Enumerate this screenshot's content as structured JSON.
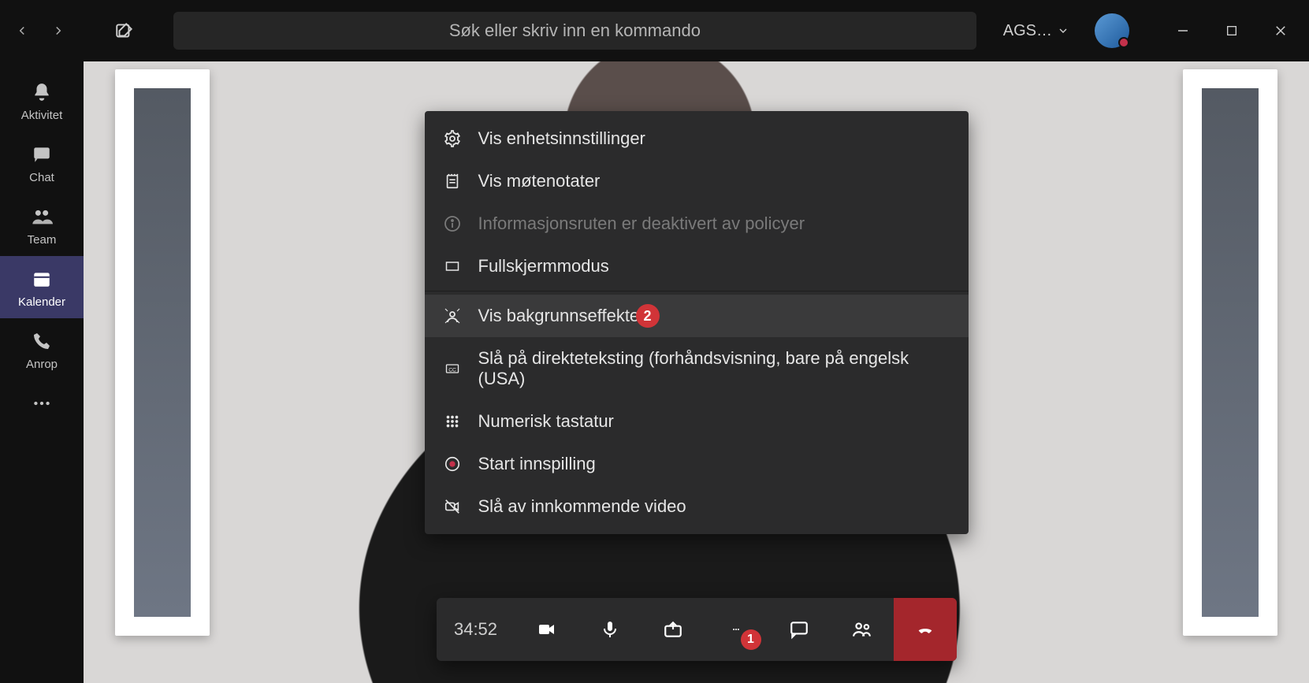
{
  "titlebar": {
    "search_placeholder": "Søk eller skriv inn en kommando",
    "org_label": "AGS…"
  },
  "sidebar": {
    "items": [
      {
        "label": "Aktivitet"
      },
      {
        "label": "Chat"
      },
      {
        "label": "Team"
      },
      {
        "label": "Kalender"
      },
      {
        "label": "Anrop"
      }
    ],
    "active_index": 3
  },
  "menu": {
    "items": [
      {
        "label": "Vis enhetsinnstillinger",
        "disabled": false
      },
      {
        "label": "Vis møtenotater",
        "disabled": false
      },
      {
        "label": "Informasjonsruten er deaktivert av policyer",
        "disabled": true
      },
      {
        "label": "Fullskjermmodus",
        "disabled": false
      }
    ],
    "items2": [
      {
        "label": "Vis bakgrunnseffekter",
        "disabled": false,
        "badge": "2"
      },
      {
        "label": "Slå på direkteteksting (forhåndsvisning, bare på engelsk (USA)",
        "disabled": false
      },
      {
        "label": "Numerisk tastatur",
        "disabled": false
      },
      {
        "label": "Start innspilling",
        "disabled": false
      },
      {
        "label": "Slå av innkommende video",
        "disabled": false
      }
    ]
  },
  "controls": {
    "timer": "34:52",
    "more_badge": "1"
  },
  "colors": {
    "hangup": "#a4262c",
    "badge": "#d13438",
    "active_nav": "#3a3966"
  }
}
